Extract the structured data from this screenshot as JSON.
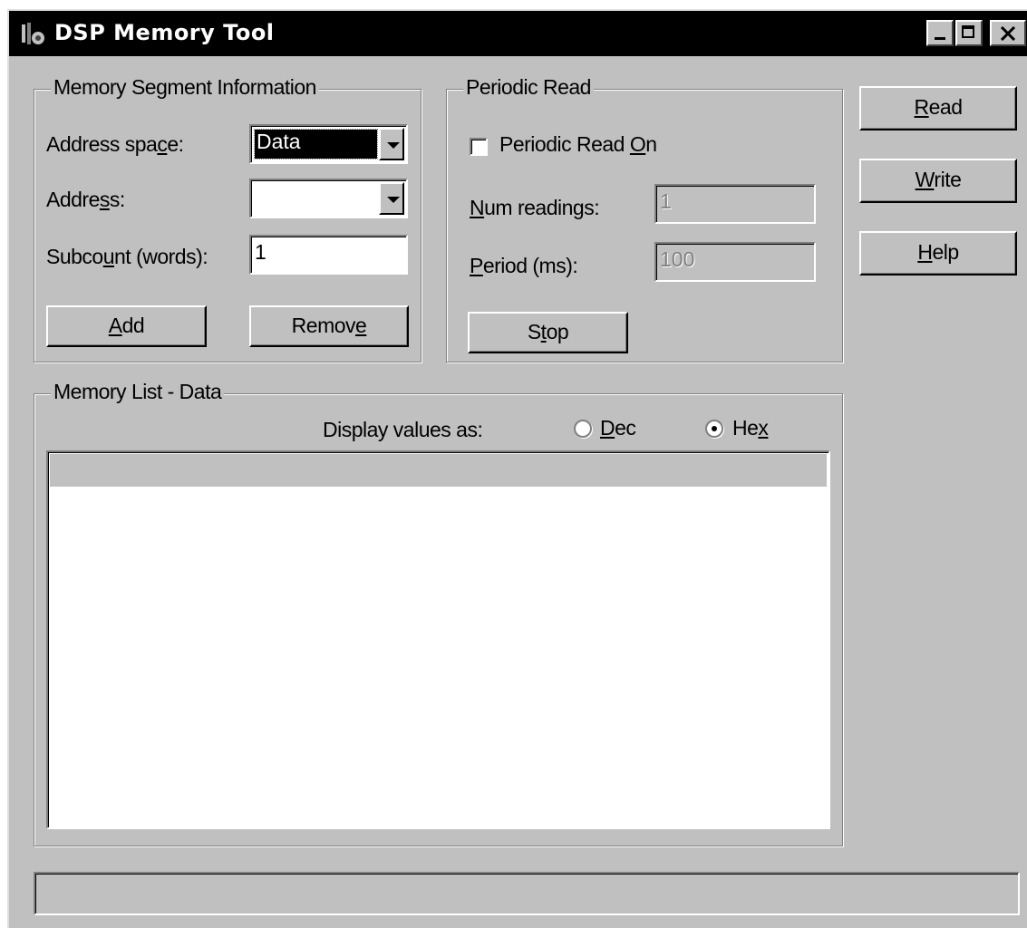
{
  "window": {
    "title": "DSP Memory Tool",
    "icon": "tools-icon"
  },
  "segment": {
    "legend": "Memory Segment Information",
    "address_space_label_pre": "Address spa",
    "address_space_label_ul": "c",
    "address_space_label_post": "e:",
    "address_space_value": "Data",
    "address_label_pre": "Addre",
    "address_label_ul": "s",
    "address_label_post": "s:",
    "address_value": "",
    "subcount_label_pre": "Subco",
    "subcount_label_ul": "u",
    "subcount_label_post": "nt (words):",
    "subcount_value": "1",
    "add_ul": "A",
    "add_rest": "dd",
    "remove_pre": "Remov",
    "remove_ul": "e",
    "remove_post": ""
  },
  "periodic": {
    "legend": "Periodic Read",
    "checkbox_label_pre": "Periodic Read ",
    "checkbox_label_ul": "O",
    "checkbox_label_post": "n",
    "checkbox_checked": false,
    "num_readings_ul": "N",
    "num_readings_rest": "um readings:",
    "num_readings_value": "1",
    "period_ul": "P",
    "period_rest": "eriod (ms):",
    "period_value": "100",
    "stop_pre": "S",
    "stop_ul": "t",
    "stop_post": "op"
  },
  "side_buttons": {
    "read_ul": "R",
    "read_rest": "ead",
    "write_ul": "W",
    "write_rest": "rite",
    "help_ul": "H",
    "help_rest": "elp"
  },
  "memory_list": {
    "legend": "Memory List - Data",
    "display_label": "Display values as:",
    "dec_ul": "D",
    "dec_rest": "ec",
    "hex_pre": "He",
    "hex_ul": "x",
    "selected": "Hex"
  },
  "status_bar": {
    "text": ""
  }
}
